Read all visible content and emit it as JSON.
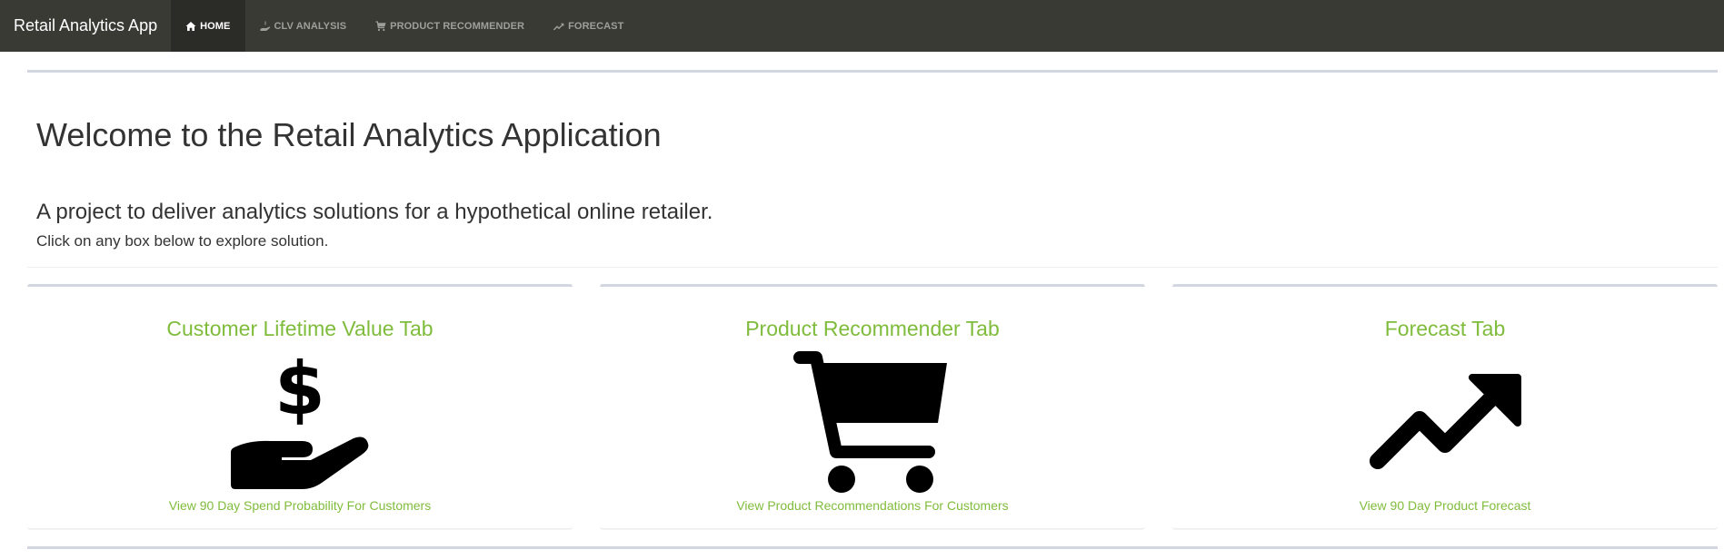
{
  "navbar": {
    "brand": "Retail Analytics App",
    "items": [
      {
        "label": "HOME",
        "icon": "home-icon",
        "active": true
      },
      {
        "label": "CLV ANALYSIS",
        "icon": "hand-holding-dollar-icon",
        "active": false
      },
      {
        "label": "PRODUCT RECOMMENDER",
        "icon": "shopping-cart-icon",
        "active": false
      },
      {
        "label": "FORECAST",
        "icon": "trend-up-icon",
        "active": false
      }
    ]
  },
  "hero": {
    "title": "Welcome to the Retail Analytics Application",
    "subtitle": "A project to deliver analytics solutions for a hypothetical online retailer.",
    "instruction": "Click on any box below to explore solution."
  },
  "cards": [
    {
      "title": "Customer Lifetime Value Tab",
      "icon": "hand-holding-dollar-icon",
      "link": "View 90 Day Spend Probability For Customers"
    },
    {
      "title": "Product Recommender Tab",
      "icon": "shopping-cart-icon",
      "link": "View Product Recommendations For Customers"
    },
    {
      "title": "Forecast Tab",
      "icon": "trend-up-icon",
      "link": "View 90 Day Product Forecast"
    }
  ],
  "colors": {
    "navbar_bg": "#3a3a35",
    "navbar_active_bg": "#2b2b27",
    "accent_green": "#80bc3c",
    "box_border": "#d2d6de"
  }
}
